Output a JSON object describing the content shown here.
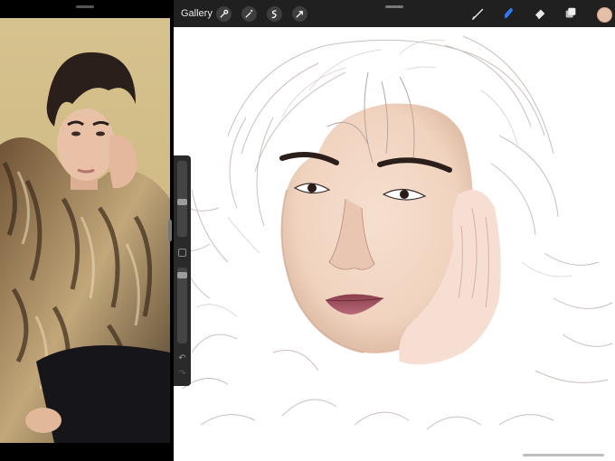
{
  "toolbar": {
    "gallery_label": "Gallery",
    "left_tools": [
      "wrench-icon",
      "magic-wand-icon",
      "selection-icon",
      "transform-arrow-icon"
    ],
    "right_tools": [
      "brush-icon",
      "smudge-icon",
      "eraser-icon",
      "layers-icon"
    ],
    "active_tool": "smudge-icon",
    "accent_color": "#2f7bf5",
    "current_color": "#e6bfa8"
  },
  "sidebar": {
    "brush_size_level": 0.55,
    "opacity_level": 0.06,
    "controls": [
      "brush-size-slider",
      "modify-button",
      "opacity-slider",
      "undo-button",
      "redo-button"
    ]
  },
  "colors": {
    "toolbar_bg": "#202020",
    "canvas_bg": "#ffffff",
    "skin_tone": "#f4dccb",
    "lip_color": "#a65664",
    "sketch_line": "#b9aaa6"
  }
}
